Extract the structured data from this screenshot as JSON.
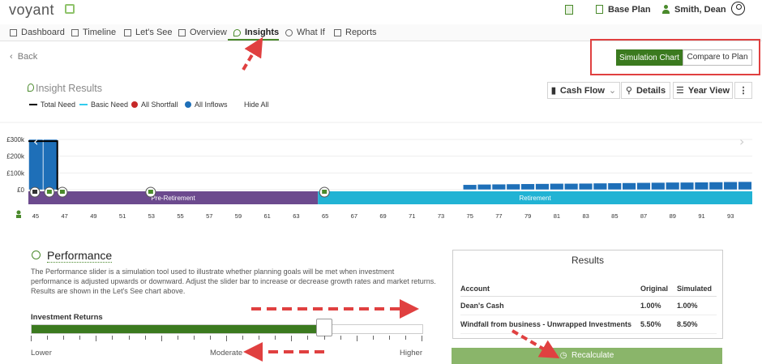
{
  "header": {
    "brand": "voyant",
    "plan_label": "Base Plan",
    "user_name": "Smith, Dean"
  },
  "nav": {
    "tabs": [
      {
        "label": "Dashboard"
      },
      {
        "label": "Timeline"
      },
      {
        "label": "Let's See"
      },
      {
        "label": "Overview"
      },
      {
        "label": "Insights",
        "active": true
      },
      {
        "label": "What If"
      },
      {
        "label": "Reports"
      }
    ]
  },
  "back_label": "Back",
  "view_toggle": {
    "simulation": "Simulation Chart",
    "compare": "Compare to Plan",
    "selected": "Simulation Chart"
  },
  "insight": {
    "title": "Insight Results",
    "legend": [
      {
        "label": "Total Need",
        "color": "#000000"
      },
      {
        "label": "Basic Need",
        "color": "#33ccee"
      },
      {
        "label": "All Shortfall",
        "color": "#c62828"
      },
      {
        "label": "All Inflows",
        "color": "#1e6fb8"
      }
    ],
    "hide_all": "Hide All",
    "toolbar": {
      "cash_flow": "Cash Flow",
      "details": "Details",
      "year_view": "Year View"
    }
  },
  "chart_data": {
    "type": "bar",
    "title": "",
    "xlabel": "",
    "ylabel": "",
    "ylim": [
      0,
      300000
    ],
    "y_ticks": [
      "£300k",
      "£200k",
      "£100k",
      "£0"
    ],
    "x_ticks": [
      "45",
      "47",
      "49",
      "51",
      "53",
      "55",
      "57",
      "59",
      "61",
      "63",
      "65",
      "67",
      "69",
      "71",
      "73",
      "75",
      "77",
      "79",
      "81",
      "83",
      "85",
      "87",
      "89",
      "91",
      "93"
    ],
    "x": [
      45,
      46,
      75,
      76,
      77,
      78,
      79,
      80,
      81,
      82,
      83,
      84,
      85,
      86,
      87,
      88,
      89,
      90,
      91,
      92,
      93,
      94
    ],
    "series": [
      {
        "name": "All Inflows",
        "color": "#1e6fb8",
        "values": [
          300000,
          300000,
          30000,
          32000,
          33000,
          34000,
          35000,
          36000,
          37000,
          37000,
          38000,
          39000,
          40000,
          41000,
          42000,
          43000,
          44000,
          44000,
          45000,
          46000,
          47000,
          48000
        ]
      }
    ],
    "total_need": {
      "x_start": 45,
      "x_end": 46,
      "value": 290000
    },
    "phases": [
      {
        "label": "Pre-Retirement",
        "start": 45,
        "end": 65,
        "color": "#6c4a8e"
      },
      {
        "label": "Retirement",
        "start": 65,
        "end": 95,
        "color": "#21b3d4"
      }
    ],
    "grid": true
  },
  "performance": {
    "title": "Performance",
    "description": "The Performance slider is a simulation tool used to illustrate whether planning goals will be met when investment performance is adjusted upwards or downward. Adjust the slider bar to increase or decrease growth rates and market returns. Results are shown in the Let's See chart above.",
    "slider_label": "Investment Returns",
    "slider_value_percent": 75,
    "labels": {
      "low": "Lower",
      "mid": "Moderate",
      "high": "Higher"
    }
  },
  "results": {
    "title": "Results",
    "columns": [
      "Account",
      "Original",
      "Simulated"
    ],
    "rows": [
      {
        "account": "Dean's Cash",
        "original": "1.00%",
        "simulated": "1.00%"
      },
      {
        "account": "Windfall from business - Unwrapped Investments",
        "original": "5.50%",
        "simulated": "8.50%"
      }
    ],
    "recalculate": "Recalculate"
  }
}
